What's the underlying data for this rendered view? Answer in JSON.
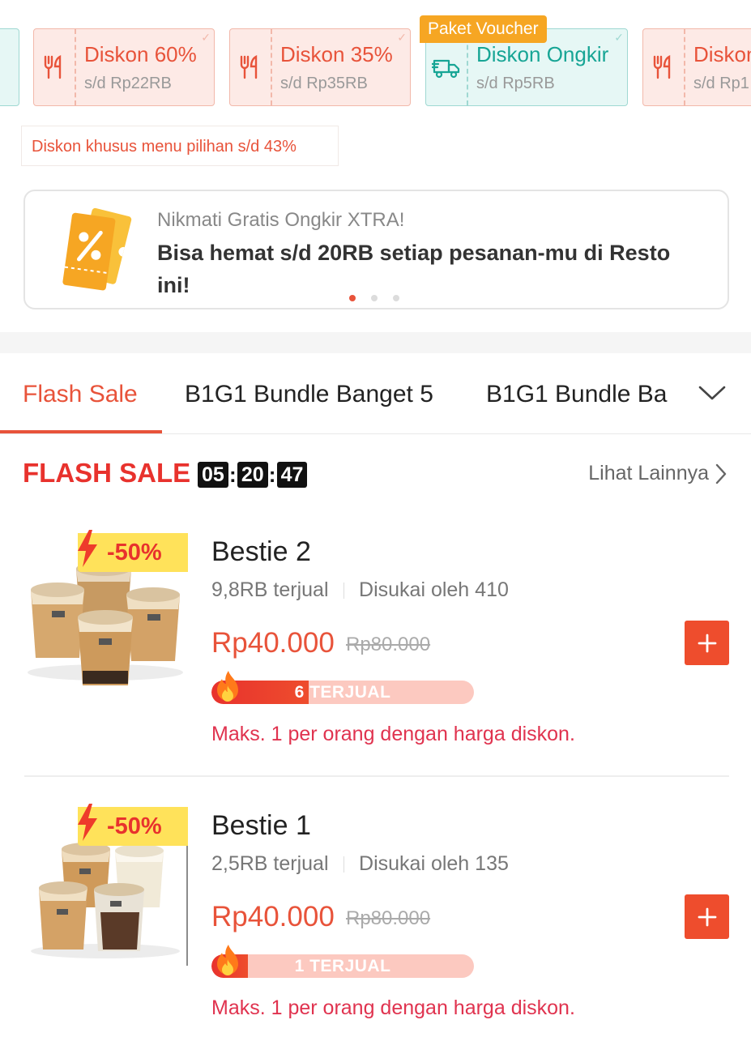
{
  "vouchers": [
    {
      "title": "",
      "sub": "",
      "style": "green-partial"
    },
    {
      "title": "Diskon 60%",
      "sub": "s/d Rp22RB",
      "icon": "utensils-icon"
    },
    {
      "title": "Diskon 35%",
      "sub": "s/d Rp35RB",
      "icon": "utensils-icon"
    },
    {
      "title": "Diskon Ongkir",
      "sub": "s/d Rp5RB",
      "icon": "delivery-truck-icon",
      "tag": "Paket Voucher"
    },
    {
      "title": "Diskon",
      "sub": "s/d Rp1",
      "icon": "utensils-icon"
    }
  ],
  "special_discount": "Diskon khusus menu pilihan s/d 43%",
  "promo": {
    "line1": "Nikmati Gratis Ongkir XTRA!",
    "line2": "Bisa hemat s/d 20RB setiap pesanan-mu di Resto ini!",
    "icon": "percent-ticket-icon",
    "dots": 3,
    "active_dot": 1
  },
  "tabs": [
    {
      "label": "Flash Sale",
      "active": true
    },
    {
      "label": "B1G1 Bundle Banget 5",
      "active": false
    },
    {
      "label": "B1G1 Bundle Ba",
      "active": false
    }
  ],
  "flash_sale": {
    "logo": "FLASH SALE",
    "timer": {
      "hours": "05",
      "minutes": "20",
      "seconds": "47"
    },
    "see_more": "Lihat Lainnya"
  },
  "products": [
    {
      "name": "Bestie 2",
      "discount": "-50%",
      "sold": "9,8RB terjual",
      "likes": "Disukai oleh 410",
      "price": "Rp40.000",
      "old_price": "Rp80.000",
      "sold_progress_label": "6 TERJUAL",
      "sold_progress": 0.37,
      "limit": "Maks. 1 per orang dengan harga diskon."
    },
    {
      "name": "Bestie 1",
      "discount": "-50%",
      "sold": "2,5RB terjual",
      "likes": "Disukai oleh 135",
      "price": "Rp40.000",
      "old_price": "Rp80.000",
      "sold_progress_label": "1 TERJUAL",
      "sold_progress": 0.14,
      "limit": "Maks. 1 per orang dengan harga diskon."
    }
  ],
  "colors": {
    "accent": "#ee4d2d",
    "green": "#17a595",
    "tag": "#f6a623",
    "badge": "#ffe25a"
  }
}
